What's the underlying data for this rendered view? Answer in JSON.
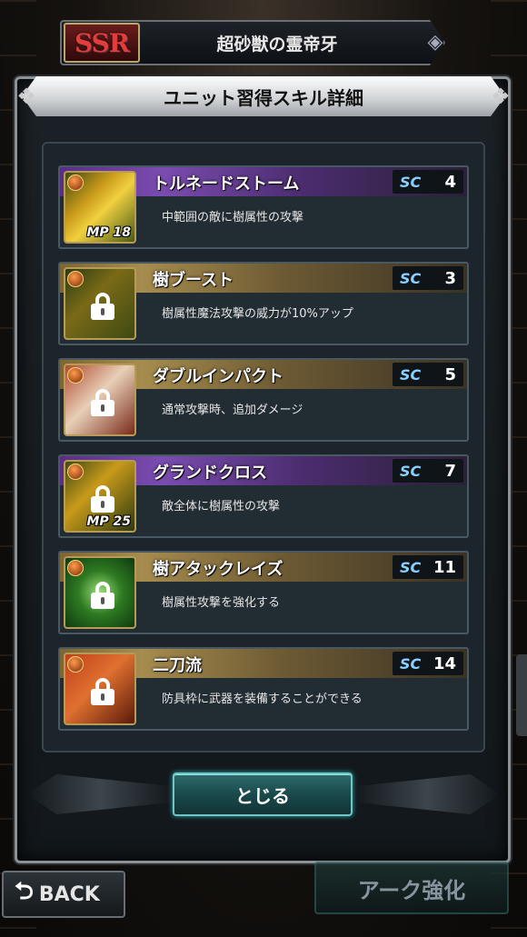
{
  "unit": {
    "rarity": "SSR",
    "name": "超砂獣の霊帝牙"
  },
  "dialog": {
    "title": "ユニット習得スキル詳細",
    "close_label": "とじる"
  },
  "sc_label": "SC",
  "skills": [
    {
      "name": "トルネードストーム",
      "sc": "4",
      "desc": "中範囲の敵に樹属性の攻撃",
      "mp": "MP 18",
      "locked": false,
      "theme": "purple"
    },
    {
      "name": "樹ブースト",
      "sc": "3",
      "desc": "樹属性魔法攻撃の威力が10%アップ",
      "mp": "",
      "locked": true,
      "theme": "gold"
    },
    {
      "name": "ダブルインパクト",
      "sc": "5",
      "desc": "通常攻撃時、追加ダメージ",
      "mp": "",
      "locked": true,
      "theme": "gold"
    },
    {
      "name": "グランドクロス",
      "sc": "7",
      "desc": "敵全体に樹属性の攻撃",
      "mp": "MP 25",
      "locked": true,
      "theme": "purple"
    },
    {
      "name": "樹アタックレイズ",
      "sc": "11",
      "desc": "樹属性攻撃を強化する",
      "mp": "",
      "locked": true,
      "theme": "gold"
    },
    {
      "name": "二刀流",
      "sc": "14",
      "desc": "防具枠に武器を装備することができる",
      "mp": "",
      "locked": true,
      "theme": "gold"
    }
  ],
  "footer": {
    "back_label": "BACK",
    "ark_label": "アーク強化"
  },
  "colors": {
    "gold_header": "#a68c4e",
    "purple_header": "#7a4cb0",
    "sc_text": "#8ad0ff",
    "close_border": "#6dc6c8"
  }
}
